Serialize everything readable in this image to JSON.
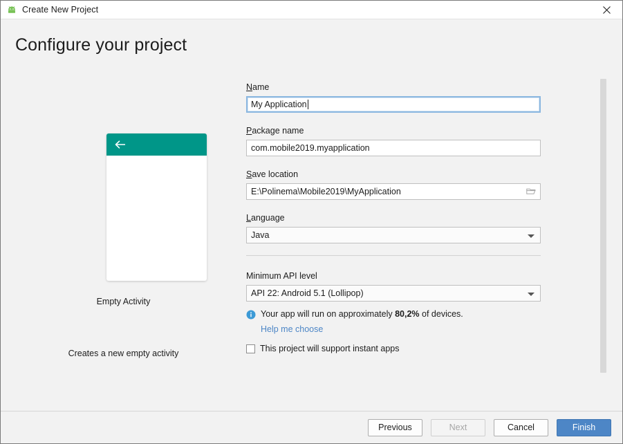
{
  "window": {
    "title": "Create New Project",
    "app_icon": "android-robot-icon",
    "close_icon": "close-icon"
  },
  "heading": "Configure your project",
  "preview": {
    "appbar_icon": "back-arrow-icon",
    "template_name": "Empty Activity",
    "template_description": "Creates a new empty activity"
  },
  "form": {
    "name": {
      "label_mnemonic": "N",
      "label_rest": "ame",
      "value": "My Application"
    },
    "package_name": {
      "label_mnemonic": "P",
      "label_rest": "ackage name",
      "value": "com.mobile2019.myapplication"
    },
    "save_location": {
      "label_mnemonic": "S",
      "label_rest": "ave location",
      "value": "E:\\Polinema\\Mobile2019\\MyApplication",
      "browse_icon": "folder-icon"
    },
    "language": {
      "label_mnemonic": "L",
      "label_rest": "anguage",
      "value": "Java"
    },
    "min_api": {
      "label": "Minimum API level",
      "value": "API 22: Android 5.1 (Lollipop)"
    },
    "api_info": {
      "icon": "info-icon",
      "text_before": "Your app will run on approximately ",
      "percent": "80,2%",
      "text_after": " of devices.",
      "help_link": "Help me choose"
    },
    "instant_apps": {
      "label": "This project will support instant apps",
      "checked": false
    }
  },
  "footer": {
    "previous": "Previous",
    "next": "Next",
    "cancel": "Cancel",
    "finish": "Finish"
  },
  "colors": {
    "accent_teal": "#009688",
    "primary_button": "#4d86c6",
    "link": "#4d86c6",
    "info_badge": "#3c9ad6",
    "background": "#f2f2f2"
  }
}
